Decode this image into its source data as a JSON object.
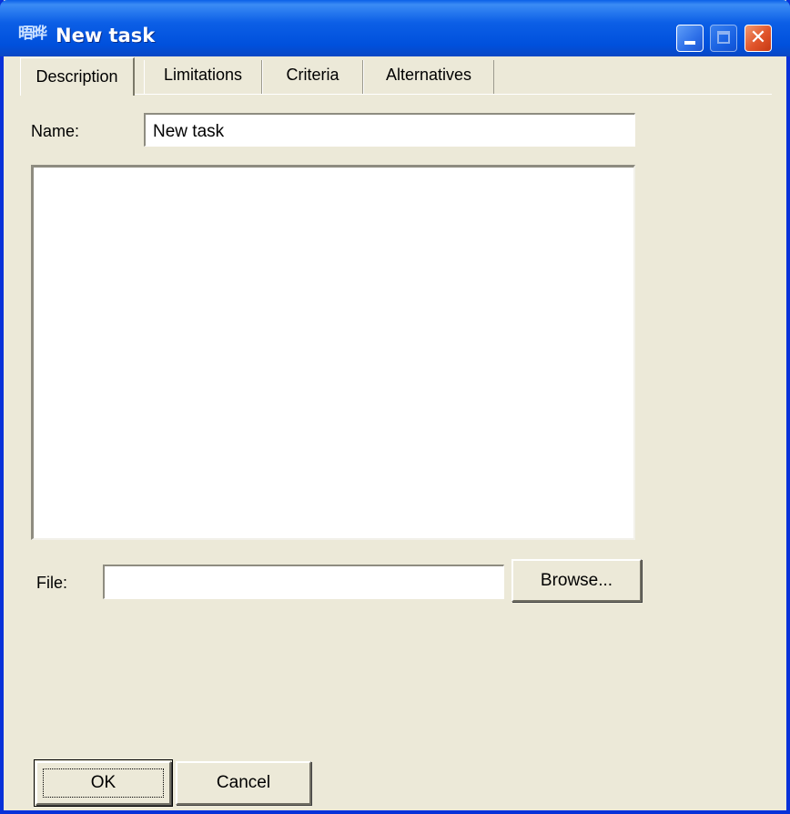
{
  "window": {
    "title": "New task",
    "icon": "app-icon",
    "icon_glyph": "晤晔",
    "controls": {
      "minimize": "minimize-icon",
      "maximize": "maximize-icon",
      "close": "close-icon",
      "close_glyph": "✕"
    },
    "colors": {
      "titlebar": "#0054e3",
      "frame": "#0831d9",
      "face": "#ece9d8",
      "close": "#e0542a"
    }
  },
  "tabs": [
    {
      "label": "Description",
      "active": true
    },
    {
      "label": "Limitations",
      "active": false
    },
    {
      "label": "Criteria",
      "active": false
    },
    {
      "label": "Alternatives",
      "active": false
    }
  ],
  "form": {
    "name_label": "Name:",
    "name_value": "New task",
    "description_value": "",
    "file_label": "File:",
    "file_value": "",
    "browse_label": "Browse..."
  },
  "buttons": {
    "ok_label": "OK",
    "cancel_label": "Cancel"
  }
}
